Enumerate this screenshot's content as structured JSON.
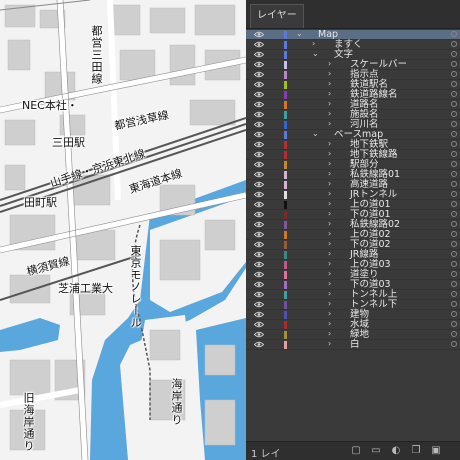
{
  "map": {
    "labels": {
      "nec": "NEC本社・",
      "mita_line": "都営三田線",
      "mita_station": "三田駅",
      "asakusa_line": "都営浅草線",
      "yamanote": "山手線・京浜東北線",
      "tokaido": "東海道本線",
      "tamachi": "田町駅",
      "yokosuka": "横須賀線",
      "monorail": "東京モノレール",
      "shibaura": "芝浦工業大",
      "canal1": "旧海岸通り",
      "canal2": "海岸通り"
    }
  },
  "panel": {
    "tab_label": "レイヤー",
    "footer_count": "1 レイ",
    "eye_icon": "eye-icon",
    "layers": [
      {
        "name": "Map",
        "level": 0,
        "expanded": true,
        "selected": true,
        "color": "#5a7bd8"
      },
      {
        "name": "ますく",
        "level": 1,
        "expanded": false,
        "color": "#5a7bd8"
      },
      {
        "name": "文字",
        "level": 1,
        "expanded": true,
        "color": "#5a7bd8"
      },
      {
        "name": "スケールバー",
        "level": 2,
        "expanded": false,
        "color": "#c9c0ea"
      },
      {
        "name": "指示点",
        "level": 2,
        "expanded": false,
        "color": "#b986c9"
      },
      {
        "name": "鉄道駅名",
        "level": 2,
        "expanded": false,
        "color": "#a0c020"
      },
      {
        "name": "鉄道路線名",
        "level": 2,
        "expanded": false,
        "color": "#8040b0"
      },
      {
        "name": "道路名",
        "level": 2,
        "expanded": false,
        "color": "#cc7a2a"
      },
      {
        "name": "施設名",
        "level": 2,
        "expanded": false,
        "color": "#3fa0a0"
      },
      {
        "name": "河川名",
        "level": 2,
        "expanded": false,
        "color": "#3366cc"
      },
      {
        "name": "ベースmap",
        "level": 1,
        "expanded": true,
        "color": "#5a7bd8"
      },
      {
        "name": "地下鉄駅",
        "level": 2,
        "expanded": false,
        "color": "#b03030"
      },
      {
        "name": "地下鉄線路",
        "level": 2,
        "expanded": false,
        "color": "#b03030"
      },
      {
        "name": "駅部分",
        "level": 2,
        "expanded": false,
        "color": "#c28a2a"
      },
      {
        "name": "私鉄線路01",
        "level": 2,
        "expanded": false,
        "color": "#d4b4d4"
      },
      {
        "name": "高速道路",
        "level": 2,
        "expanded": false,
        "color": "#d4b4d4"
      },
      {
        "name": "JRトンネル",
        "level": 2,
        "expanded": false,
        "color": "#e0e0e0"
      },
      {
        "name": "上の道01",
        "level": 2,
        "expanded": false,
        "color": "#111111"
      },
      {
        "name": "下の道01",
        "level": 2,
        "expanded": false,
        "color": "#7a2a2a"
      },
      {
        "name": "私鉄線路02",
        "level": 2,
        "expanded": false,
        "color": "#7a5a9a"
      },
      {
        "name": "上の道02",
        "level": 2,
        "expanded": false,
        "color": "#cc7a2a"
      },
      {
        "name": "下の道02",
        "level": 2,
        "expanded": false,
        "color": "#9a5a3a"
      },
      {
        "name": "JR線路",
        "level": 2,
        "expanded": false,
        "color": "#3a8a8a"
      },
      {
        "name": "上の道03",
        "level": 2,
        "expanded": false,
        "color": "#c05a8a"
      },
      {
        "name": "道塗り",
        "level": 2,
        "expanded": false,
        "color": "#e070a0"
      },
      {
        "name": "下の道03",
        "level": 2,
        "expanded": false,
        "color": "#a070c0"
      },
      {
        "name": "トンネル上",
        "level": 2,
        "expanded": false,
        "color": "#40a0a0"
      },
      {
        "name": "トンネル下",
        "level": 2,
        "expanded": false,
        "color": "#7050a0"
      },
      {
        "name": "建物",
        "level": 2,
        "expanded": false,
        "color": "#5050b0"
      },
      {
        "name": "水域",
        "level": 2,
        "expanded": false,
        "color": "#a03030"
      },
      {
        "name": "緑地",
        "level": 2,
        "expanded": false,
        "color": "#a09040"
      },
      {
        "name": "白",
        "level": 2,
        "expanded": false,
        "color": "#e0a0a0"
      }
    ]
  }
}
